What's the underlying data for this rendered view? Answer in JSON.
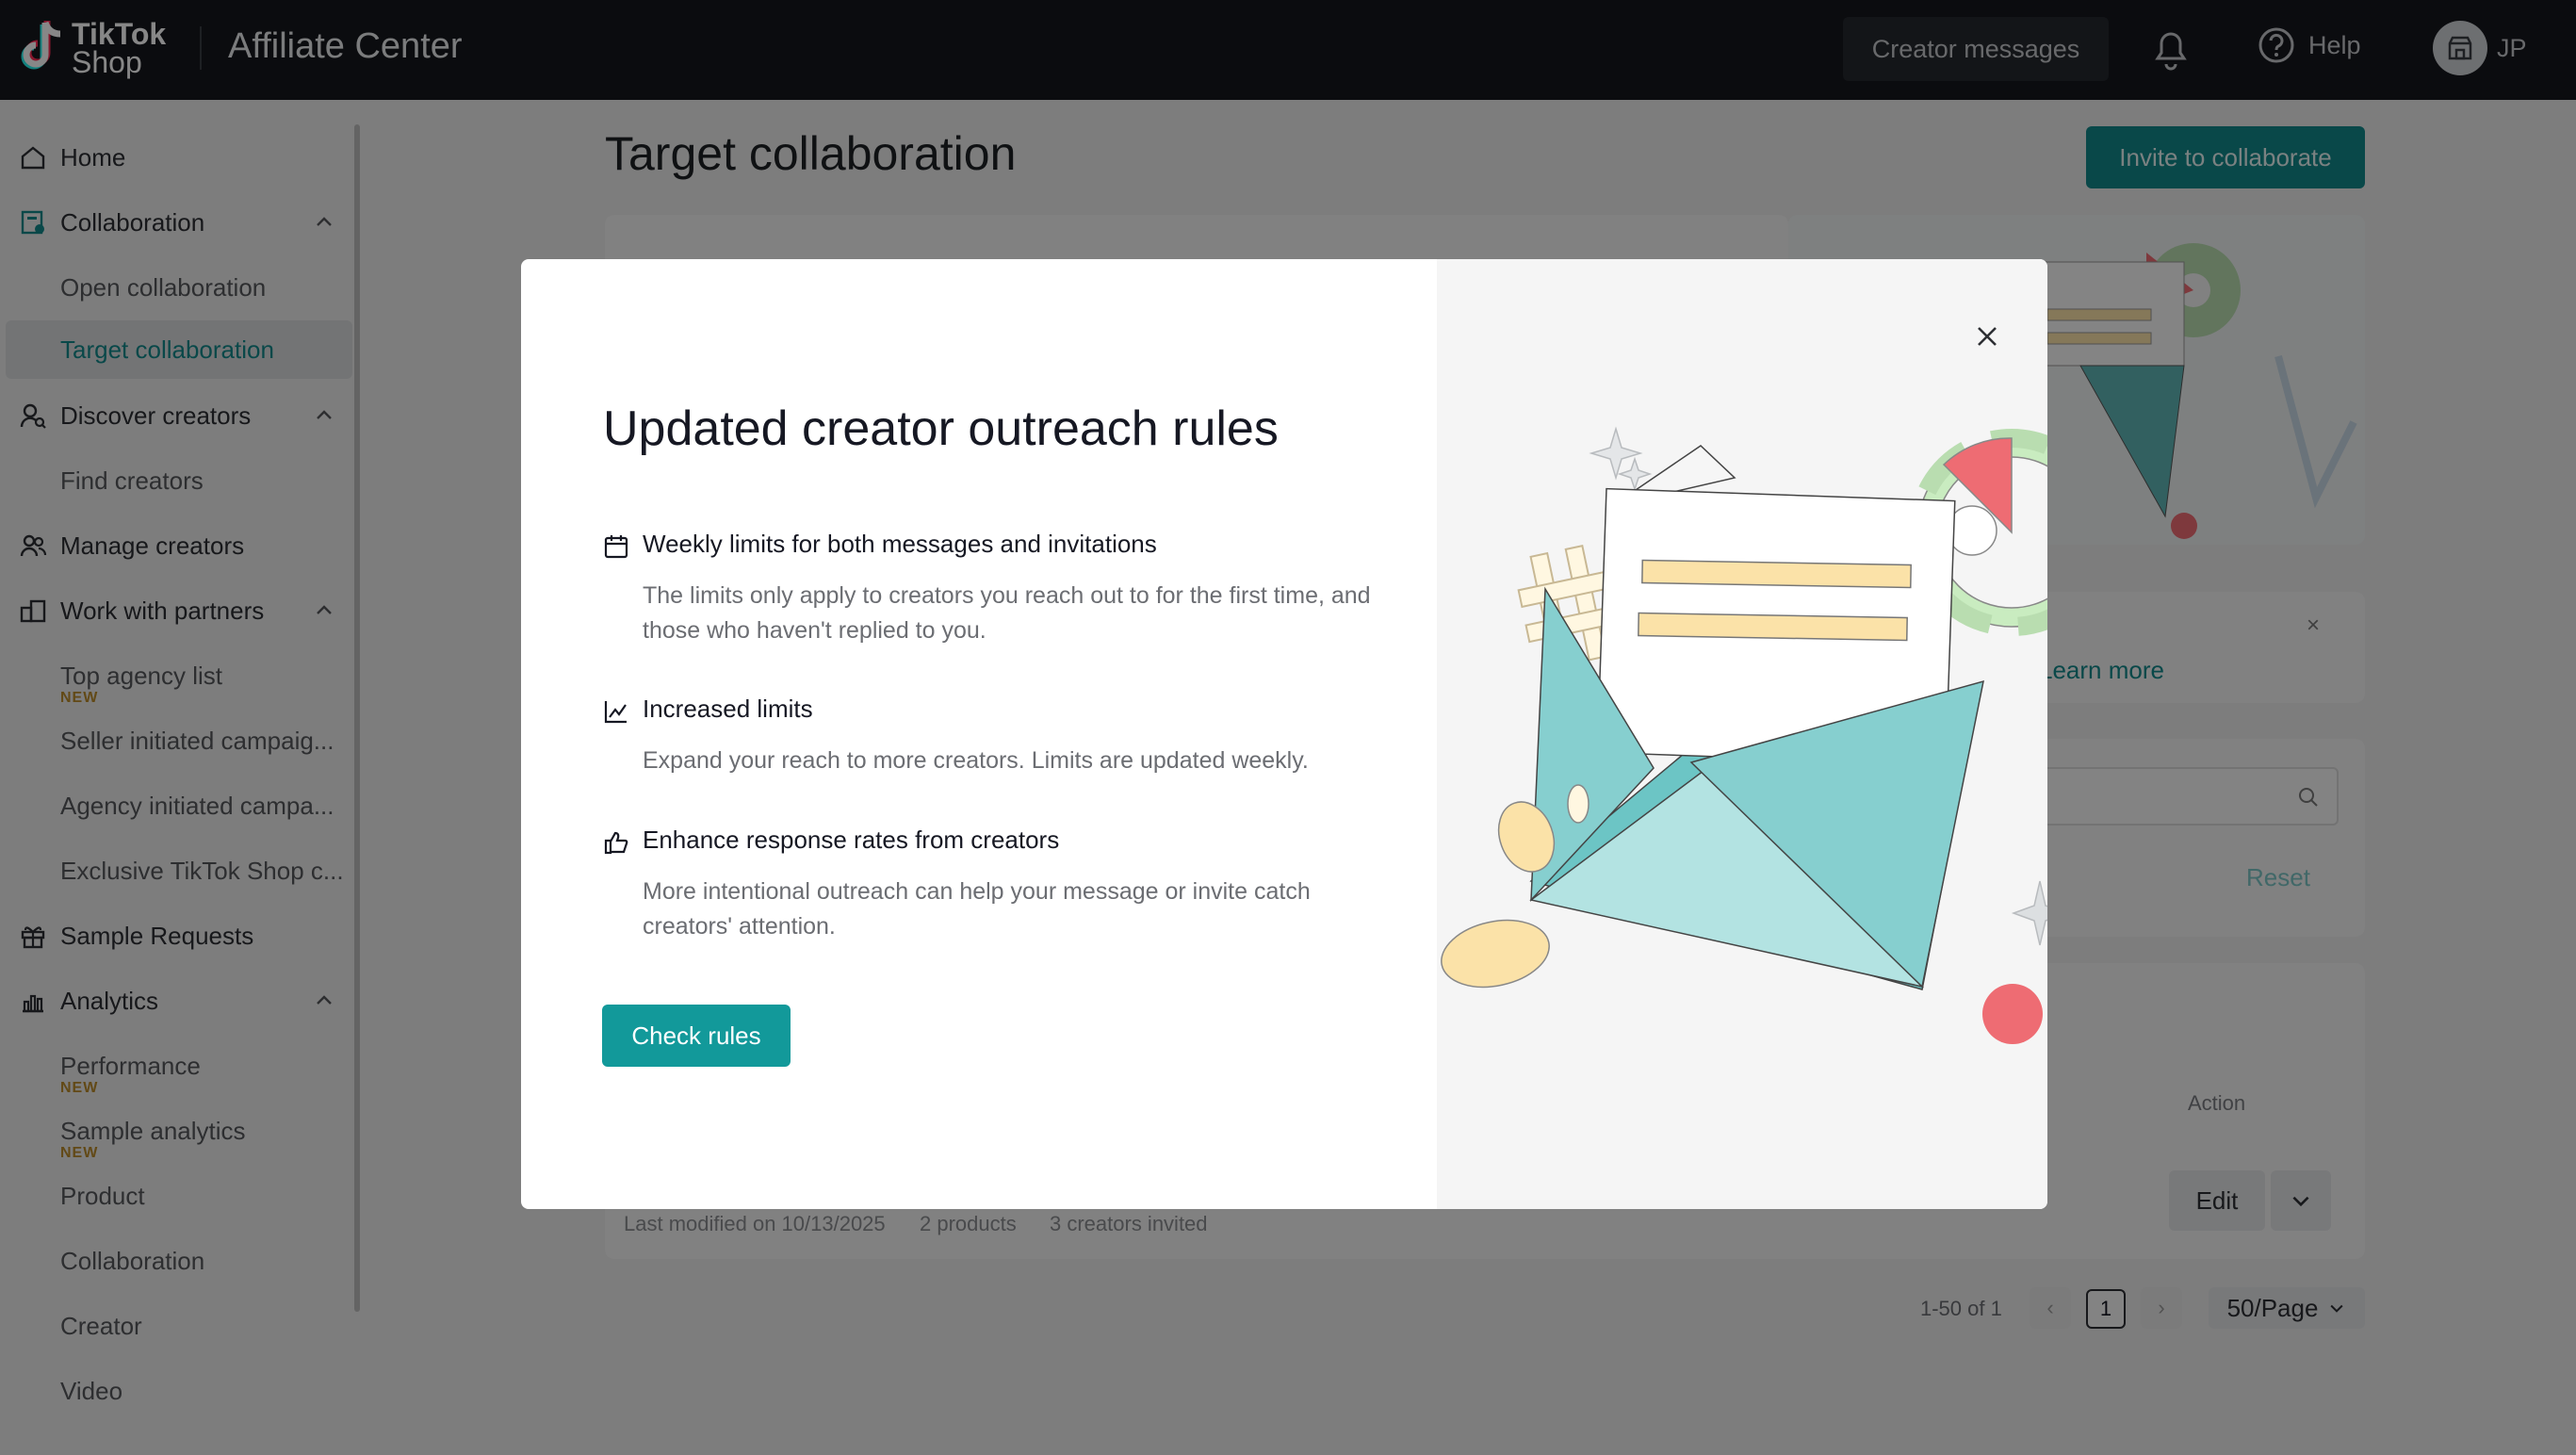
{
  "header": {
    "logo_line1": "TikTok",
    "logo_line2": "Shop",
    "app_title": "Affiliate Center",
    "creator_messages": "Creator messages",
    "help": "Help",
    "account_initials": "JP"
  },
  "sidebar": {
    "items": [
      {
        "label": "Home",
        "icon": "home-icon"
      },
      {
        "label": "Collaboration",
        "icon": "collaboration-icon"
      },
      {
        "label": "Open collaboration"
      },
      {
        "label": "Target collaboration"
      },
      {
        "label": "Discover creators",
        "icon": "discover-icon"
      },
      {
        "label": "Find creators"
      },
      {
        "label": "Manage creators",
        "icon": "users-icon"
      },
      {
        "label": "Work with partners",
        "icon": "partners-icon"
      },
      {
        "label": "Top agency list",
        "badge": "NEW"
      },
      {
        "label": "Seller initiated campaig..."
      },
      {
        "label": "Agency initiated campa..."
      },
      {
        "label": "Exclusive TikTok Shop c..."
      },
      {
        "label": "Sample Requests",
        "icon": "gift-icon"
      },
      {
        "label": "Analytics",
        "icon": "analytics-icon"
      },
      {
        "label": "Performance",
        "badge": "NEW"
      },
      {
        "label": "Sample analytics",
        "badge": "NEW"
      },
      {
        "label": "Product"
      },
      {
        "label": "Collaboration"
      },
      {
        "label": "Creator"
      },
      {
        "label": "Video"
      }
    ]
  },
  "main": {
    "page_title": "Target collaboration",
    "invite_button": "Invite to collaborate",
    "learn_more": "Learn more",
    "reset": "Reset",
    "action_header": "Action",
    "edit": "Edit",
    "row_meta": [
      "Last modified on 10/13/2025",
      "2 products",
      "3 creators invited"
    ],
    "pagination": {
      "range": "1-50 of 1",
      "current": "1",
      "per_page": "50/Page"
    }
  },
  "modal": {
    "title": "Updated creator outreach rules",
    "rules": [
      {
        "icon": "calendar-icon",
        "title": "Weekly limits for both messages and invitations",
        "desc": "The limits only apply to creators you reach out to for the first time, and those who haven't replied to you."
      },
      {
        "icon": "chart-line-icon",
        "title": "Increased limits",
        "desc": "Expand your reach to more creators. Limits are updated weekly."
      },
      {
        "icon": "thumbs-up-icon",
        "title": "Enhance response rates from creators",
        "desc": "More intentional outreach can help your message or invite catch creators' attention."
      }
    ],
    "check_button": "Check rules"
  },
  "colors": {
    "brand_teal": "#12999a",
    "header_bg": "#15181d",
    "accent_red": "#ee6c73",
    "accent_yellow": "#fbe2a8"
  }
}
